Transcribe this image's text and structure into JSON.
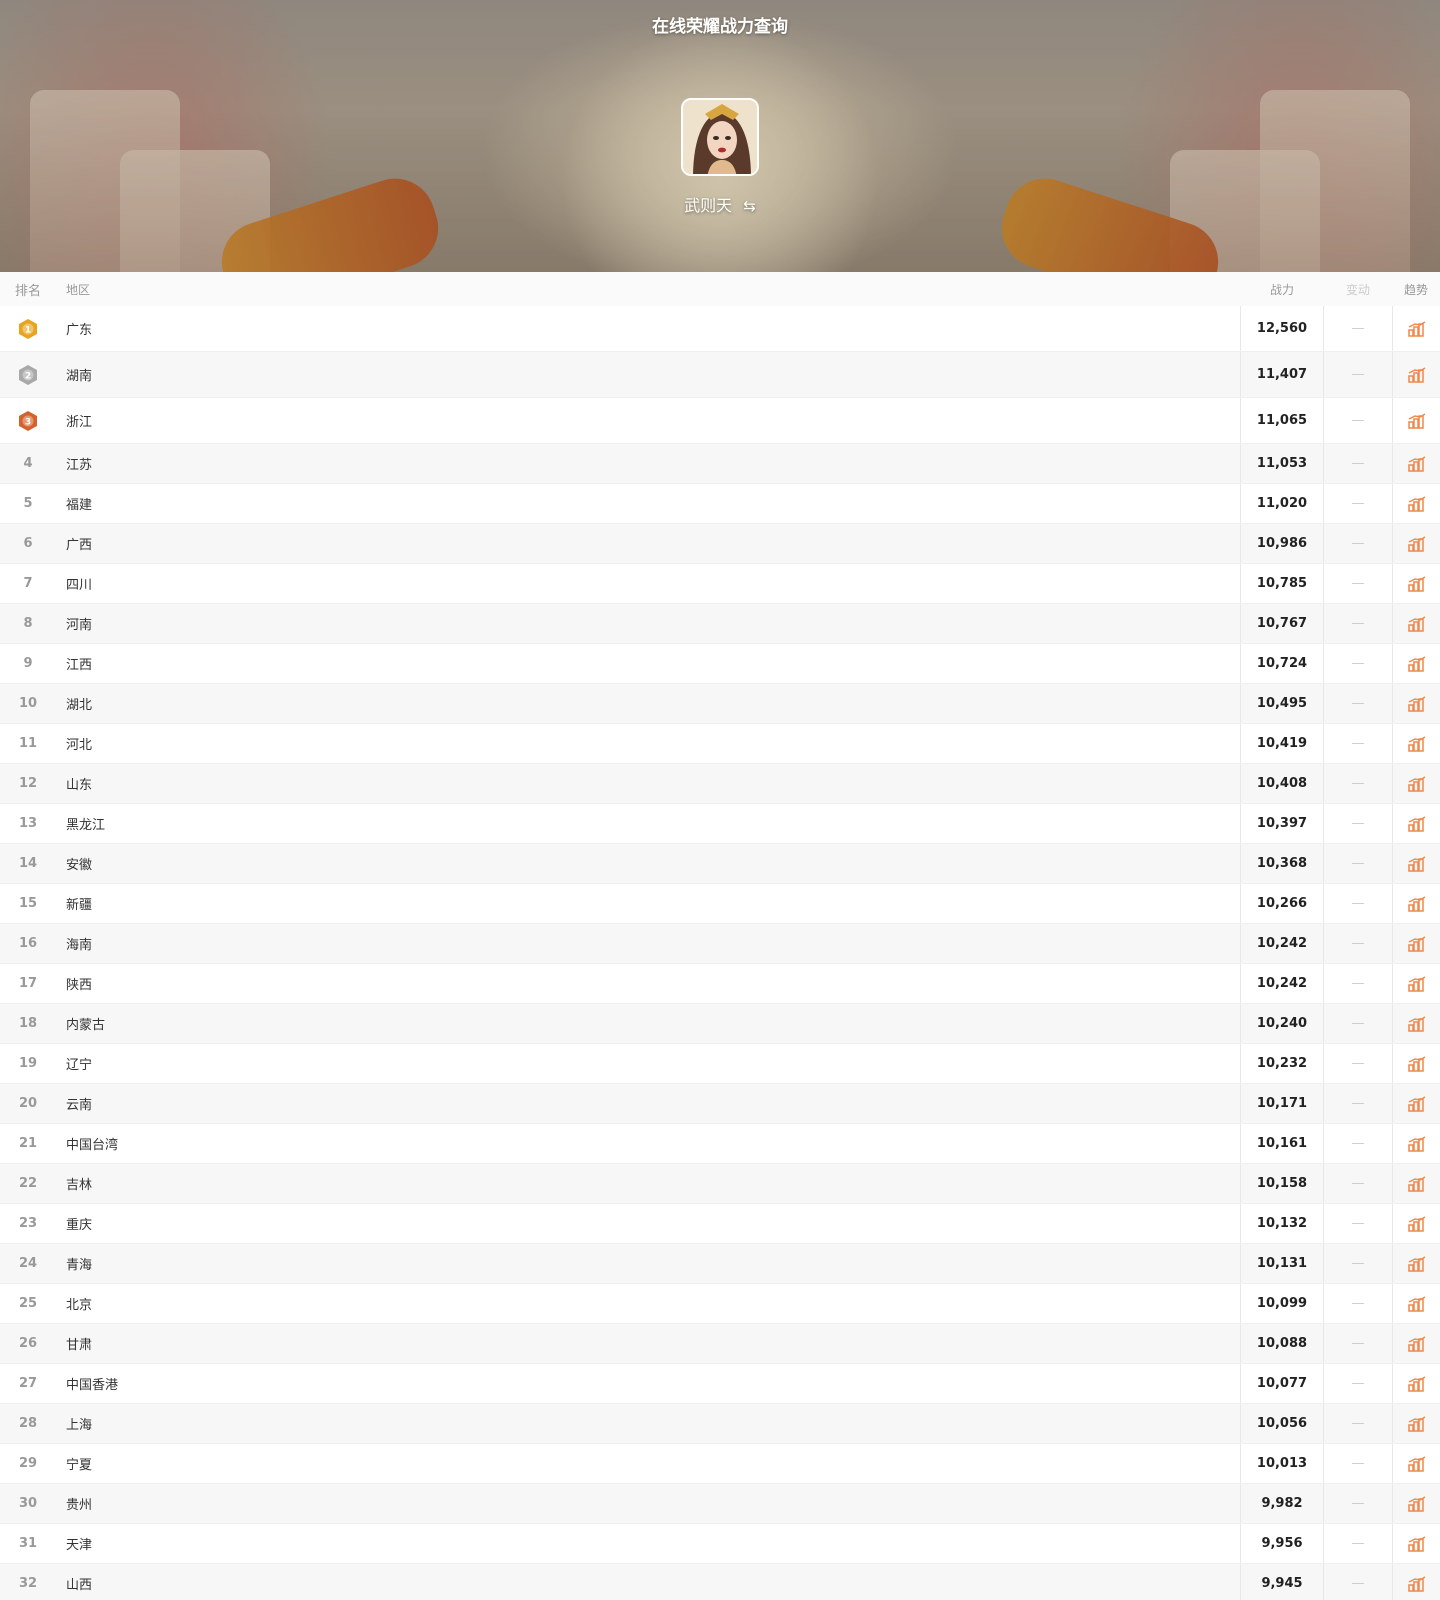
{
  "header": {
    "title": "在线荣耀战力查询",
    "hero_name": "武则天",
    "swap_symbol": "⇆"
  },
  "table": {
    "columns": {
      "rank": "排名",
      "region": "地区",
      "power": "战力",
      "change": "变动",
      "trend": "趋势"
    },
    "change_placeholder": "—",
    "rows": [
      {
        "rank": "1",
        "region": "广东",
        "power": "12,560"
      },
      {
        "rank": "2",
        "region": "湖南",
        "power": "11,407"
      },
      {
        "rank": "3",
        "region": "浙江",
        "power": "11,065"
      },
      {
        "rank": "4",
        "region": "江苏",
        "power": "11,053"
      },
      {
        "rank": "5",
        "region": "福建",
        "power": "11,020"
      },
      {
        "rank": "6",
        "region": "广西",
        "power": "10,986"
      },
      {
        "rank": "7",
        "region": "四川",
        "power": "10,785"
      },
      {
        "rank": "8",
        "region": "河南",
        "power": "10,767"
      },
      {
        "rank": "9",
        "region": "江西",
        "power": "10,724"
      },
      {
        "rank": "10",
        "region": "湖北",
        "power": "10,495"
      },
      {
        "rank": "11",
        "region": "河北",
        "power": "10,419"
      },
      {
        "rank": "12",
        "region": "山东",
        "power": "10,408"
      },
      {
        "rank": "13",
        "region": "黑龙江",
        "power": "10,397"
      },
      {
        "rank": "14",
        "region": "安徽",
        "power": "10,368"
      },
      {
        "rank": "15",
        "region": "新疆",
        "power": "10,266"
      },
      {
        "rank": "16",
        "region": "海南",
        "power": "10,242"
      },
      {
        "rank": "17",
        "region": "陕西",
        "power": "10,242"
      },
      {
        "rank": "18",
        "region": "内蒙古",
        "power": "10,240"
      },
      {
        "rank": "19",
        "region": "辽宁",
        "power": "10,232"
      },
      {
        "rank": "20",
        "region": "云南",
        "power": "10,171"
      },
      {
        "rank": "21",
        "region": "中国台湾",
        "power": "10,161"
      },
      {
        "rank": "22",
        "region": "吉林",
        "power": "10,158"
      },
      {
        "rank": "23",
        "region": "重庆",
        "power": "10,132"
      },
      {
        "rank": "24",
        "region": "青海",
        "power": "10,131"
      },
      {
        "rank": "25",
        "region": "北京",
        "power": "10,099"
      },
      {
        "rank": "26",
        "region": "甘肃",
        "power": "10,088"
      },
      {
        "rank": "27",
        "region": "中国香港",
        "power": "10,077"
      },
      {
        "rank": "28",
        "region": "上海",
        "power": "10,056"
      },
      {
        "rank": "29",
        "region": "宁夏",
        "power": "10,013"
      },
      {
        "rank": "30",
        "region": "贵州",
        "power": "9,982"
      },
      {
        "rank": "31",
        "region": "天津",
        "power": "9,956"
      },
      {
        "rank": "32",
        "region": "山西",
        "power": "9,945"
      }
    ]
  },
  "colors": {
    "gold_medal": "#e8a420",
    "silver_medal": "#a9a9a9",
    "bronze_medal": "#d4622c",
    "trend_icon": "#f0894a"
  },
  "icons": {
    "medal": "medal-icon",
    "trend": "bar-chart-icon",
    "swap": "swap-arrows-icon"
  }
}
